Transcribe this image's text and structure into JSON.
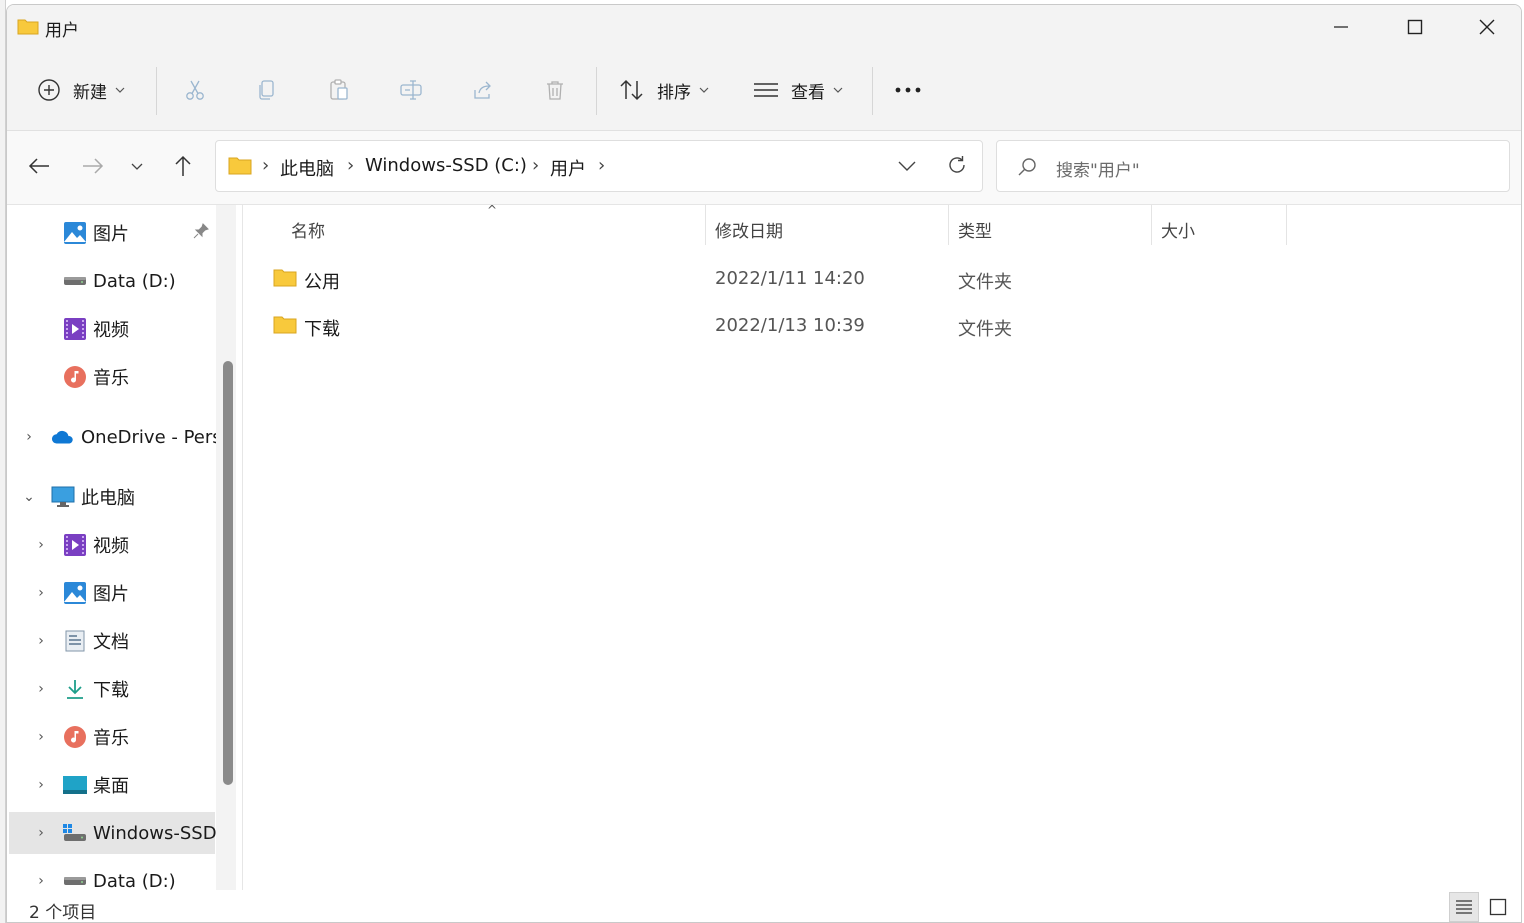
{
  "window": {
    "title": "用户"
  },
  "commands": {
    "new": "新建",
    "sort": "排序",
    "view": "查看",
    "more": "..."
  },
  "address": {
    "crumbs": [
      "此电脑",
      "Windows-SSD (C:)",
      "用户"
    ]
  },
  "search": {
    "placeholder": "搜索\"用户\""
  },
  "sidebar": {
    "quick_access": [
      {
        "label": "图片",
        "icon": "pictures-icon",
        "pinned": true
      },
      {
        "label": "Data (D:)",
        "icon": "drive-icon"
      },
      {
        "label": "视频",
        "icon": "videos-icon"
      },
      {
        "label": "音乐",
        "icon": "music-icon"
      }
    ],
    "onedrive": {
      "label": "OneDrive - Pers",
      "icon": "onedrive-icon"
    },
    "this_pc": {
      "label": "此电脑",
      "icon": "computer-icon"
    },
    "pc_items": [
      {
        "label": "视频",
        "icon": "videos-icon"
      },
      {
        "label": "图片",
        "icon": "pictures-icon"
      },
      {
        "label": "文档",
        "icon": "documents-icon"
      },
      {
        "label": "下载",
        "icon": "downloads-icon"
      },
      {
        "label": "音乐",
        "icon": "music-icon"
      },
      {
        "label": "桌面",
        "icon": "desktop-icon"
      },
      {
        "label": "Windows-SSD",
        "icon": "windows-drive-icon",
        "selected": true
      },
      {
        "label": "Data (D:)",
        "icon": "drive-icon"
      }
    ]
  },
  "columns": {
    "name": "名称",
    "modified": "修改日期",
    "type": "类型",
    "size": "大小"
  },
  "files": [
    {
      "name": "公用",
      "modified": "2022/1/11 14:20",
      "type": "文件夹",
      "size": ""
    },
    {
      "name": "下载",
      "modified": "2022/1/13 10:39",
      "type": "文件夹",
      "size": ""
    }
  ],
  "status": {
    "text": "2 个项目"
  },
  "colors": {
    "folder": "#f8c93c",
    "accent": "#0067c0",
    "selected_bg": "#e5e5e5"
  }
}
